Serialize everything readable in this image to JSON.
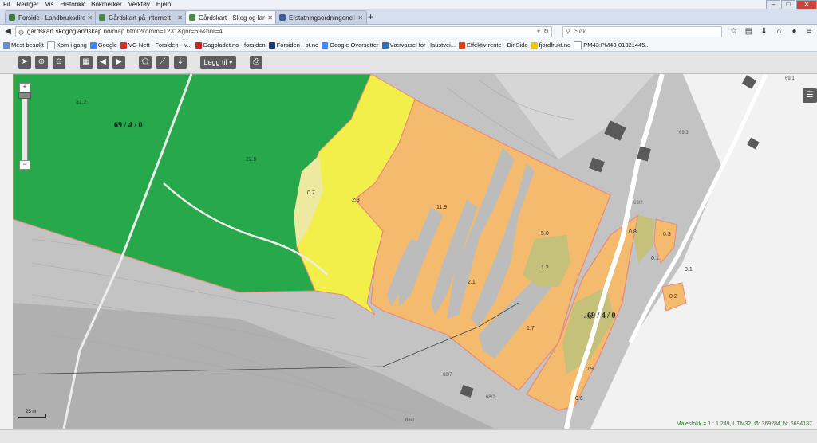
{
  "menu": [
    "Fil",
    "Rediger",
    "Vis",
    "Historikk",
    "Bokmerker",
    "Verktøy",
    "Hjelp"
  ],
  "window_controls": [
    "–",
    "□",
    "✕"
  ],
  "tabs": [
    {
      "label": "Forside - Landbruksdirekto...",
      "icon_color": "#3c7a3c"
    },
    {
      "label": "Gårdskart på Internett",
      "icon_color": "#4a8a4a"
    },
    {
      "label": "Gårdskart - Skog og landskap",
      "icon_color": "#4a8a4a"
    },
    {
      "label": "Erstatningsordningene i la...",
      "icon_color": "#3b5998"
    }
  ],
  "newtab": "+",
  "url": {
    "host": "gardskart.skogoglandskap.no",
    "path": "/map.html?komm=1231&gnr=69&bnr=4"
  },
  "search_placeholder": "Søk",
  "bookmarks": [
    {
      "label": "Mest besøkt",
      "color": "#6b8fc9"
    },
    {
      "label": "Kom i gang",
      "color": "#ffffff"
    },
    {
      "label": "Google",
      "color": "#4285f4"
    },
    {
      "label": "VG Nett - Forsiden - V...",
      "color": "#d32f2f"
    },
    {
      "label": "Dagbladet.no - forsiden",
      "color": "#c62828"
    },
    {
      "label": "Forsiden - bt.no",
      "color": "#1a3c7a"
    },
    {
      "label": "Google Oversetter",
      "color": "#4285f4"
    },
    {
      "label": "Værvarsel for Haustvei...",
      "color": "#2e6fb8"
    },
    {
      "label": "Effektiv rente - DinSide",
      "color": "#d84315"
    },
    {
      "label": "fjordfrukt.no",
      "color": "#f1c40f"
    },
    {
      "label": "PM43:PM43-01321445...",
      "color": "#ffffff"
    }
  ],
  "toolbar": {
    "add_label": "Legg til"
  },
  "map": {
    "parcel_labels": [
      "69 / 4 / 0",
      "69 / 4 / 0"
    ],
    "neighbor_labels": [
      "69/1",
      "69/3",
      "69/2",
      "68/2",
      "68/7",
      "68/7",
      "69/2"
    ],
    "area_labels": [
      "31.2",
      "22.6",
      "0.7",
      "2.3",
      "11.9",
      "5.0",
      "1.2",
      "2.1",
      "1.7",
      "4.0",
      "0.9",
      "0.6",
      "0.8",
      "0.3",
      "0.1",
      "0.2",
      "0.1",
      "0.3",
      "0.1",
      "0.1"
    ],
    "colors": {
      "forest": "#27a84a",
      "yellow": "#f3ef4a",
      "orange": "#f4bb6e",
      "grey": "#bcbcbc",
      "khaki": "#c5c07a",
      "pale": "#eee9a0"
    }
  },
  "scale_label": "25 m",
  "coords_text": "Målestokk = 1 : 1 249, UTM32: Ø: 369284, N: 6694187"
}
